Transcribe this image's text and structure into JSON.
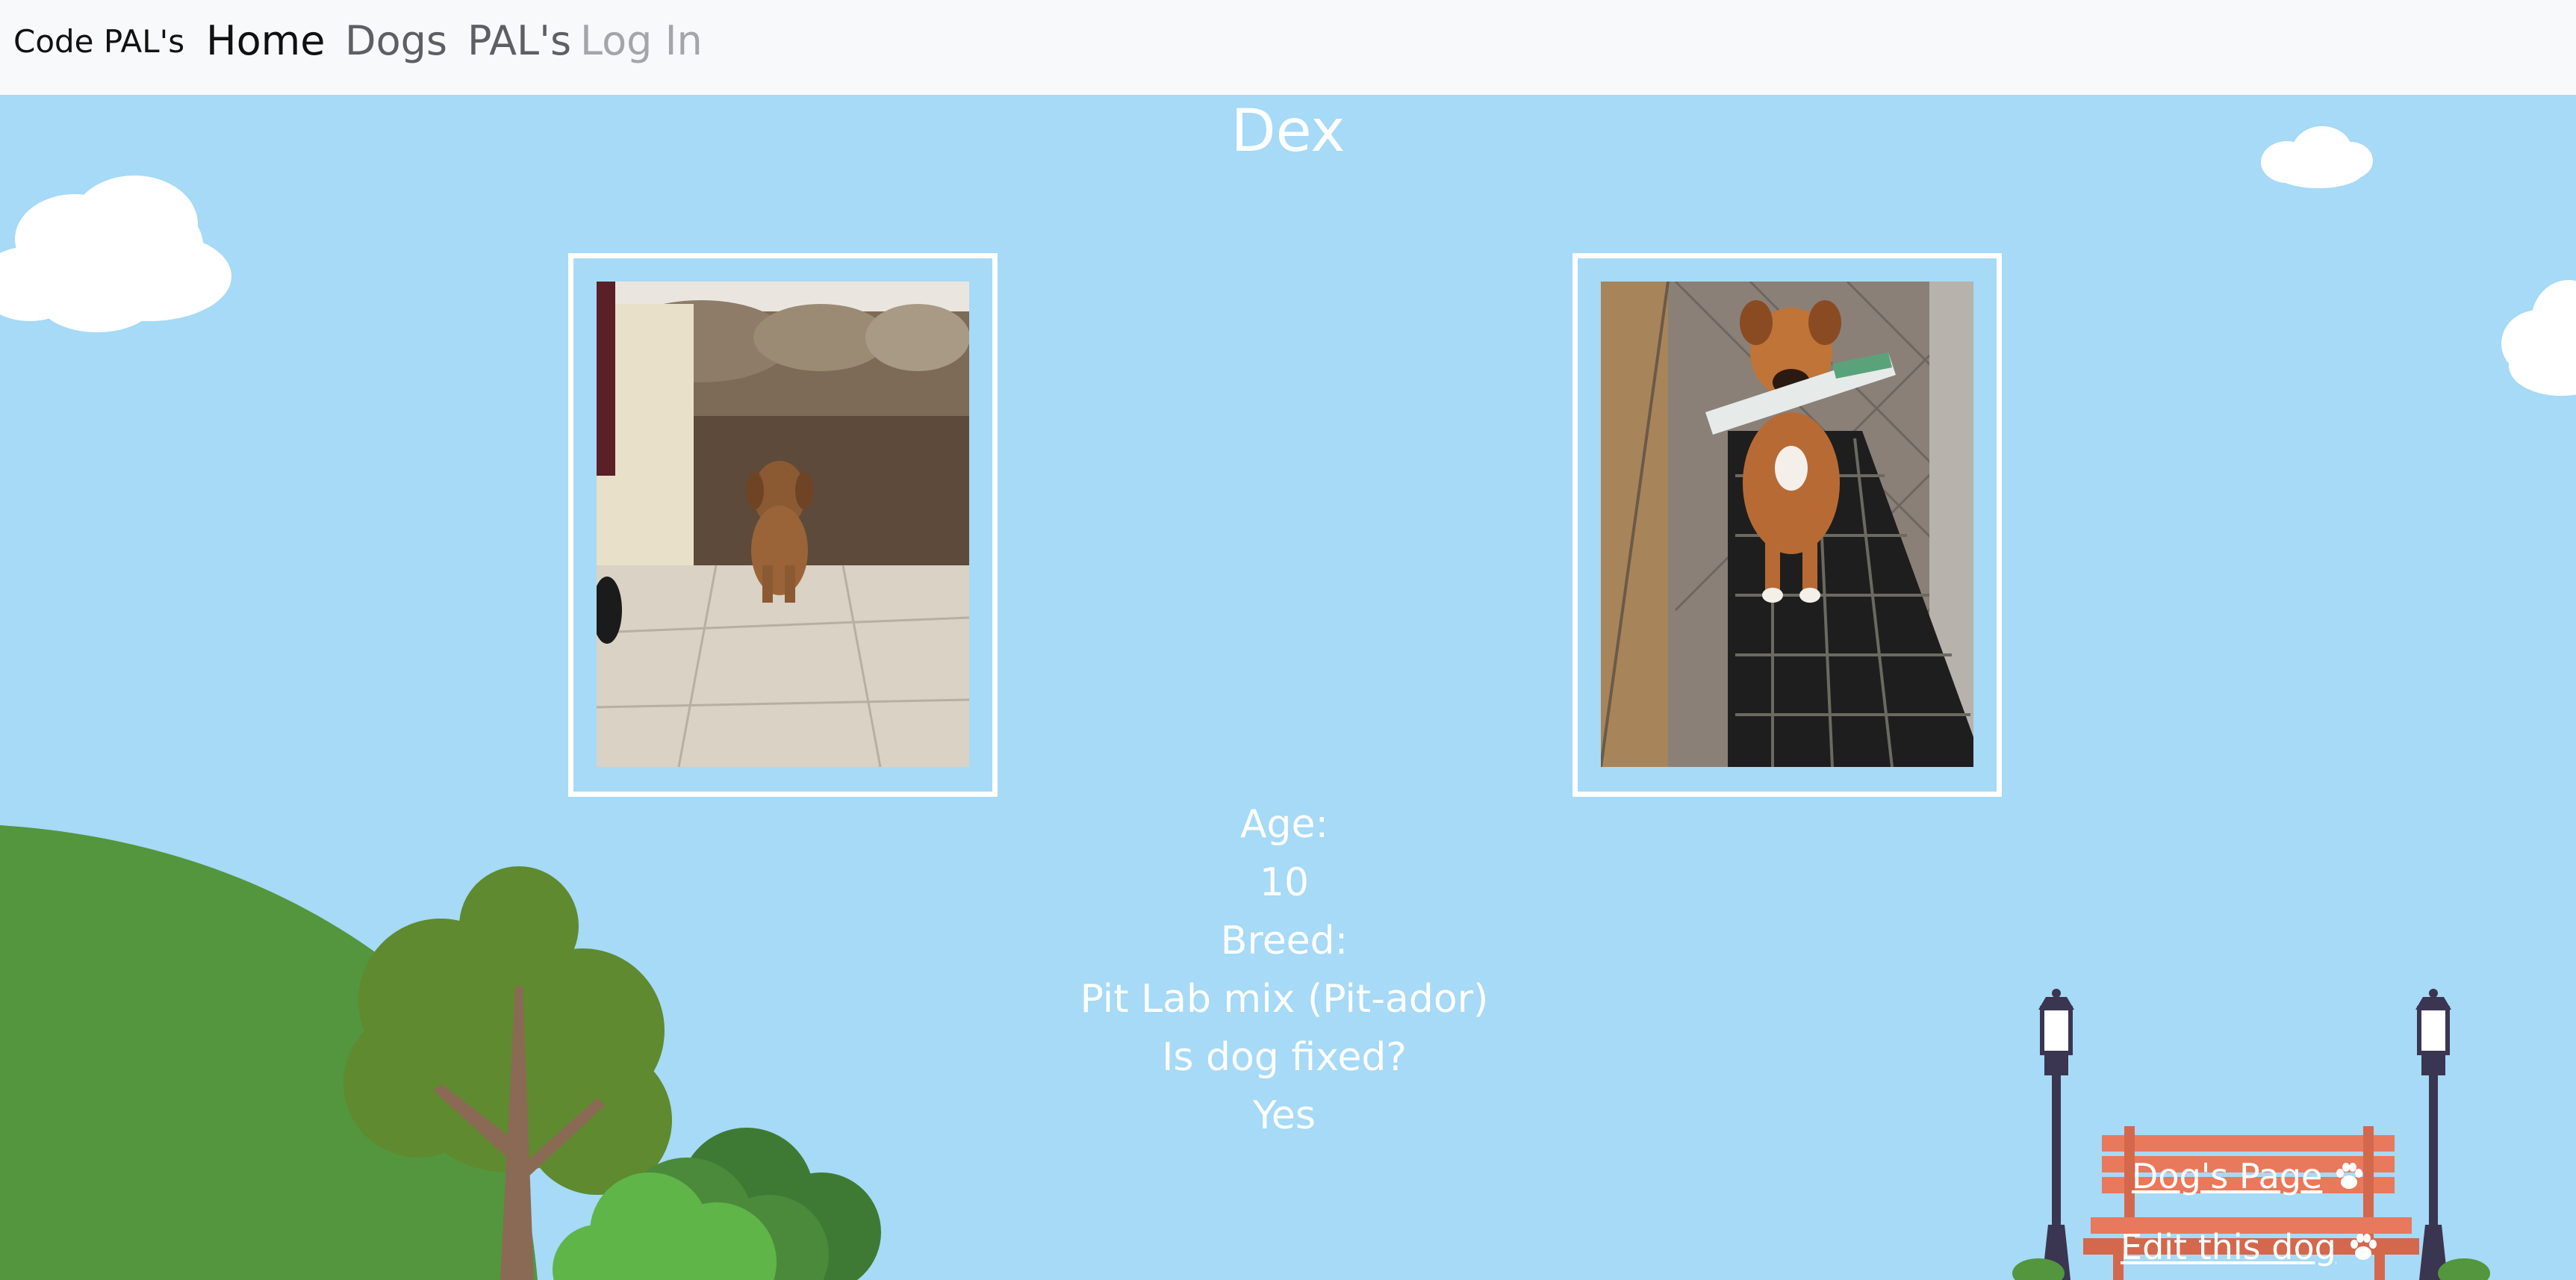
{
  "nav": {
    "brand": "Code PAL's",
    "items": [
      {
        "label": "Home"
      },
      {
        "label": "Dogs"
      },
      {
        "label": "PAL's"
      },
      {
        "label": "Log In"
      }
    ]
  },
  "dog": {
    "name": "Dex",
    "age_label": "Age:",
    "age_value": "10",
    "breed_label": "Breed:",
    "breed_value": "Pit Lab mix (Pit-ador)",
    "fixed_label": "Is dog fixed?",
    "fixed_value": "Yes"
  },
  "actions": {
    "dogs_page": "Dog's Page",
    "edit_dog": "Edit this dog"
  },
  "icons": {
    "paw": "paw-icon"
  },
  "colors": {
    "sky": "#a6daf6",
    "hill": "#53963e",
    "tree": "#5f8a2f",
    "bench": "#e8795c",
    "lamp": "#3a3550"
  }
}
